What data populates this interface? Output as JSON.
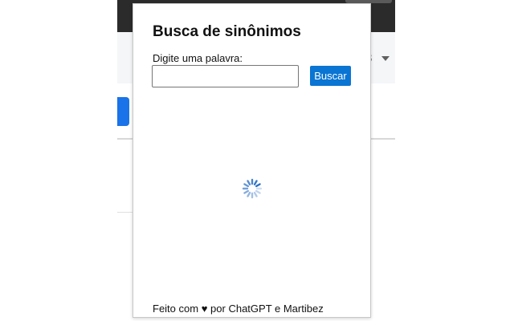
{
  "background_page": {
    "page_number_fragment": "3",
    "colors": {
      "topbar": "#2b2b2b",
      "accent_button": "#1a73e8",
      "toolbar": "#f5f6f8"
    }
  },
  "popup": {
    "title": "Busca de sinônimos",
    "input_label": "Digite uma palavra:",
    "input_value": "",
    "search_button_label": "Buscar",
    "loading_icon": "spinner-icon",
    "footer": {
      "prefix": "Feito com",
      "heart": "♥",
      "suffix": "por ChatGPT e Martibez"
    },
    "colors": {
      "button": "#0a75d3",
      "spinner": "#2a6fc4"
    }
  }
}
